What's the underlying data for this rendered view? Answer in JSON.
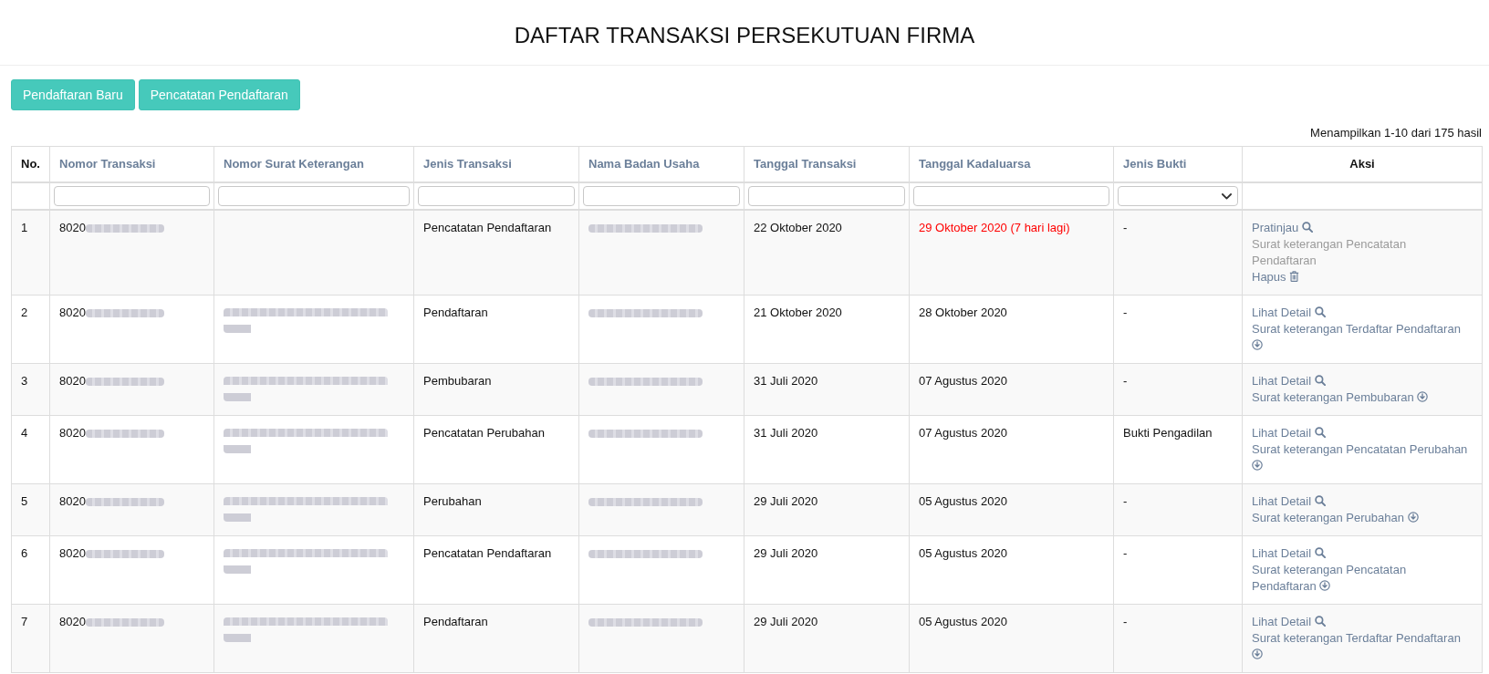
{
  "page": {
    "title": "DAFTAR TRANSAKSI PERSEKUTUAN FIRMA"
  },
  "toolbar": {
    "buttons": [
      {
        "label": "Pendaftaran Baru"
      },
      {
        "label": "Pencatatan Pendaftaran"
      }
    ]
  },
  "result_summary": "Menampilkan 1-10 dari 175 hasil",
  "table": {
    "columns": [
      {
        "label": "No.",
        "kind": "number"
      },
      {
        "label": "Nomor Transaksi",
        "kind": "sortable",
        "filter": {
          "kind": "text"
        }
      },
      {
        "label": "Nomor Surat Keterangan",
        "kind": "sortable",
        "filter": {
          "kind": "text"
        }
      },
      {
        "label": "Jenis Transaksi",
        "kind": "sortable",
        "filter": {
          "kind": "text"
        }
      },
      {
        "label": "Nama Badan Usaha",
        "kind": "sortable",
        "filter": {
          "kind": "text"
        }
      },
      {
        "label": "Tanggal Transaksi",
        "kind": "sortable",
        "filter": {
          "kind": "text"
        }
      },
      {
        "label": "Tanggal Kadaluarsa",
        "kind": "sortable",
        "filter": {
          "kind": "text"
        }
      },
      {
        "label": "Jenis Bukti",
        "kind": "sortable",
        "filter": {
          "kind": "select"
        }
      },
      {
        "label": "Aksi",
        "kind": "actions"
      }
    ],
    "rows": [
      {
        "no": "1",
        "nomor_transaksi": "8020",
        "nomor_transaksi_blurred": true,
        "nomor_surat_keterangan_blurred": false,
        "jenis_transaksi": "Pencatatan Pendaftaran",
        "nama_badan_usaha_blurred": true,
        "tanggal_transaksi": "22 Oktober 2020",
        "tanggal_kadaluarsa": "29 Oktober 2020 (7 hari lagi)",
        "expiring": true,
        "jenis_bukti": "-",
        "actions": [
          {
            "kind": "view",
            "label": "Pratinjau",
            "disabled": false
          },
          {
            "kind": "certificate",
            "label": "Surat keterangan Pencatatan Pendaftaran",
            "disabled": true
          },
          {
            "kind": "delete",
            "label": "Hapus",
            "disabled": false
          }
        ]
      },
      {
        "no": "2",
        "nomor_transaksi": "8020",
        "nomor_transaksi_blurred": true,
        "nomor_surat_keterangan_blurred": true,
        "jenis_transaksi": "Pendaftaran",
        "nama_badan_usaha_blurred": true,
        "tanggal_transaksi": "21 Oktober 2020",
        "tanggal_kadaluarsa": "28 Oktober 2020",
        "expiring": false,
        "jenis_bukti": "-",
        "actions": [
          {
            "kind": "view",
            "label": "Lihat Detail",
            "disabled": false
          },
          {
            "kind": "certificate",
            "label": "Surat keterangan Terdaftar Pendaftaran",
            "disabled": false
          }
        ]
      },
      {
        "no": "3",
        "nomor_transaksi": "8020",
        "nomor_transaksi_blurred": true,
        "nomor_surat_keterangan_blurred": true,
        "jenis_transaksi": "Pembubaran",
        "nama_badan_usaha_blurred": true,
        "tanggal_transaksi": "31 Juli 2020",
        "tanggal_kadaluarsa": "07 Agustus 2020",
        "expiring": false,
        "jenis_bukti": "-",
        "actions": [
          {
            "kind": "view",
            "label": "Lihat Detail",
            "disabled": false
          },
          {
            "kind": "certificate",
            "label": "Surat keterangan Pembubaran",
            "disabled": false
          }
        ]
      },
      {
        "no": "4",
        "nomor_transaksi": "8020",
        "nomor_transaksi_blurred": true,
        "nomor_surat_keterangan_blurred": true,
        "jenis_transaksi": "Pencatatan Perubahan",
        "nama_badan_usaha_blurred": true,
        "tanggal_transaksi": "31 Juli 2020",
        "tanggal_kadaluarsa": "07 Agustus 2020",
        "expiring": false,
        "jenis_bukti": "Bukti Pengadilan",
        "actions": [
          {
            "kind": "view",
            "label": "Lihat Detail",
            "disabled": false
          },
          {
            "kind": "certificate",
            "label": "Surat keterangan Pencatatan Perubahan",
            "disabled": false
          }
        ]
      },
      {
        "no": "5",
        "nomor_transaksi": "8020",
        "nomor_transaksi_blurred": true,
        "nomor_surat_keterangan_blurred": true,
        "jenis_transaksi": "Perubahan",
        "nama_badan_usaha_blurred": true,
        "tanggal_transaksi": "29 Juli 2020",
        "tanggal_kadaluarsa": "05 Agustus 2020",
        "expiring": false,
        "jenis_bukti": "-",
        "actions": [
          {
            "kind": "view",
            "label": "Lihat Detail",
            "disabled": false
          },
          {
            "kind": "certificate",
            "label": "Surat keterangan Perubahan",
            "disabled": false
          }
        ]
      },
      {
        "no": "6",
        "nomor_transaksi": "8020",
        "nomor_transaksi_blurred": true,
        "nomor_surat_keterangan_blurred": true,
        "jenis_transaksi": "Pencatatan Pendaftaran",
        "nama_badan_usaha_blurred": true,
        "tanggal_transaksi": "29 Juli 2020",
        "tanggal_kadaluarsa": "05 Agustus 2020",
        "expiring": false,
        "jenis_bukti": "-",
        "actions": [
          {
            "kind": "view",
            "label": "Lihat Detail",
            "disabled": false
          },
          {
            "kind": "certificate",
            "label": "Surat keterangan Pencatatan Pendaftaran",
            "disabled": false
          }
        ]
      },
      {
        "no": "7",
        "nomor_transaksi": "8020",
        "nomor_transaksi_blurred": true,
        "nomor_surat_keterangan_blurred": true,
        "jenis_transaksi": "Pendaftaran",
        "nama_badan_usaha_blurred": true,
        "tanggal_transaksi": "29 Juli 2020",
        "tanggal_kadaluarsa": "05 Agustus 2020",
        "expiring": false,
        "jenis_bukti": "-",
        "actions": [
          {
            "kind": "view",
            "label": "Lihat Detail",
            "disabled": false
          },
          {
            "kind": "certificate",
            "label": "Surat keterangan Terdaftar Pendaftaran",
            "disabled": false
          }
        ]
      }
    ]
  }
}
